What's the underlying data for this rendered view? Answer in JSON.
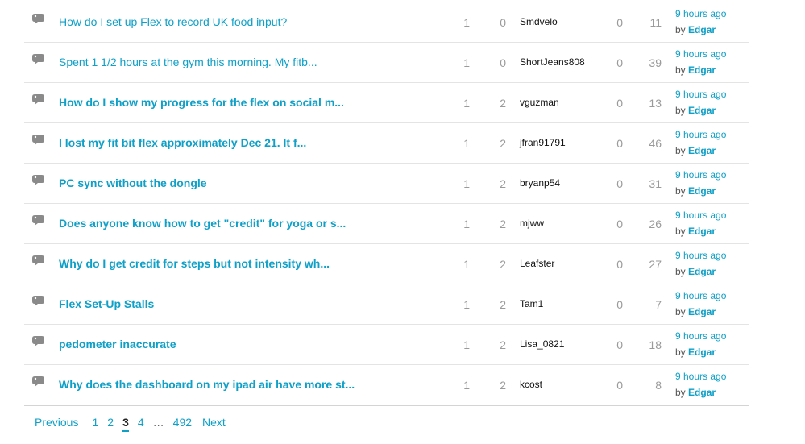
{
  "topics": [
    {
      "subject": "How do I set up Flex to record UK food input?",
      "bold": false,
      "replies": "1",
      "kudos": "0",
      "author": "Smdvelo",
      "unread": "0",
      "views": "11",
      "time": "9 hours ago",
      "by": "by",
      "last_user": "Edgar"
    },
    {
      "subject": "Spent 1 1/2 hours at the gym this morning. My fitb...",
      "bold": false,
      "replies": "1",
      "kudos": "0",
      "author": "ShortJeans808",
      "unread": "0",
      "views": "39",
      "time": "9 hours ago",
      "by": "by",
      "last_user": "Edgar"
    },
    {
      "subject": "How do I show my progress for the flex on social m...",
      "bold": true,
      "replies": "1",
      "kudos": "2",
      "author": "vguzman",
      "unread": "0",
      "views": "13",
      "time": "9 hours ago",
      "by": "by",
      "last_user": "Edgar"
    },
    {
      "subject": "I lost my fit bit flex approximately Dec 21. It f...",
      "bold": true,
      "replies": "1",
      "kudos": "2",
      "author": "jfran91791",
      "unread": "0",
      "views": "46",
      "time": "9 hours ago",
      "by": "by",
      "last_user": "Edgar"
    },
    {
      "subject": "PC sync without the dongle",
      "bold": true,
      "replies": "1",
      "kudos": "2",
      "author": "bryanp54",
      "unread": "0",
      "views": "31",
      "time": "9 hours ago",
      "by": "by",
      "last_user": "Edgar"
    },
    {
      "subject": "Does anyone know how to get \"credit\" for yoga or s...",
      "bold": true,
      "replies": "1",
      "kudos": "2",
      "author": "mjww",
      "unread": "0",
      "views": "26",
      "time": "9 hours ago",
      "by": "by",
      "last_user": "Edgar"
    },
    {
      "subject": "Why do I get credit for steps but not intensity wh...",
      "bold": true,
      "replies": "1",
      "kudos": "2",
      "author": "Leafster",
      "unread": "0",
      "views": "27",
      "time": "9 hours ago",
      "by": "by",
      "last_user": "Edgar"
    },
    {
      "subject": "Flex Set-Up Stalls",
      "bold": true,
      "replies": "1",
      "kudos": "2",
      "author": "Tam1",
      "unread": "0",
      "views": "7",
      "time": "9 hours ago",
      "by": "by",
      "last_user": "Edgar"
    },
    {
      "subject": "pedometer inaccurate",
      "bold": true,
      "replies": "1",
      "kudos": "2",
      "author": "Lisa_0821",
      "unread": "0",
      "views": "18",
      "time": "9 hours ago",
      "by": "by",
      "last_user": "Edgar"
    },
    {
      "subject": "Why does the dashboard on my ipad air have more st...",
      "bold": true,
      "replies": "1",
      "kudos": "2",
      "author": "kcost",
      "unread": "0",
      "views": "8",
      "time": "9 hours ago",
      "by": "by",
      "last_user": "Edgar"
    }
  ],
  "pagination": {
    "previous": "Previous",
    "pages": [
      "1",
      "2",
      "3",
      "4"
    ],
    "current": "3",
    "ellipsis": "…",
    "last": "492",
    "next": "Next"
  },
  "colors": {
    "link": "#0fa0c8",
    "icon": "#8a8a8a"
  },
  "icons": {
    "topic": "speech-bubble-icon"
  }
}
